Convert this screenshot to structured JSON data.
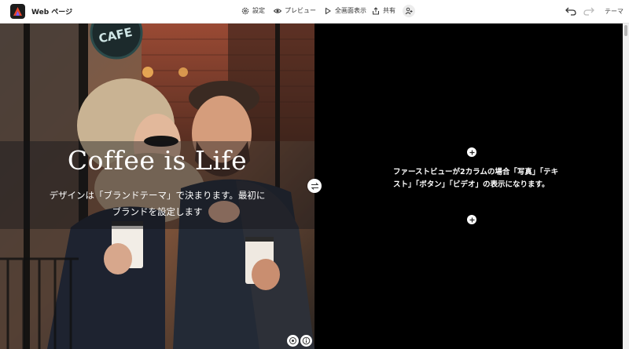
{
  "app": {
    "title": "Web ページ"
  },
  "toolbar": {
    "settings": "設定",
    "preview": "プレビュー",
    "fullscreen": "全画面表示",
    "share": "共有",
    "theme": "テーマ"
  },
  "hero": {
    "title": "Coffee is Life",
    "subtitle": "デザインは「ブランドテーマ」で決まります。最初にブランドを設定します",
    "sign_text": "CAFE"
  },
  "right_panel": {
    "text": "ファーストビューが2カラムの場合「写真」「テキスト」「ボタン」「ビデオ」の表示になります。"
  },
  "icons": [
    "app-logo-icon",
    "gear-icon",
    "eye-icon",
    "play-icon",
    "share-icon",
    "add-user-icon",
    "undo-icon",
    "redo-icon",
    "swap-icon",
    "plus-icon",
    "target-icon",
    "info-icon"
  ],
  "colors": {
    "canvas": "#000000",
    "toolbar": "#ffffff",
    "text_on_dark": "#ffffff"
  }
}
